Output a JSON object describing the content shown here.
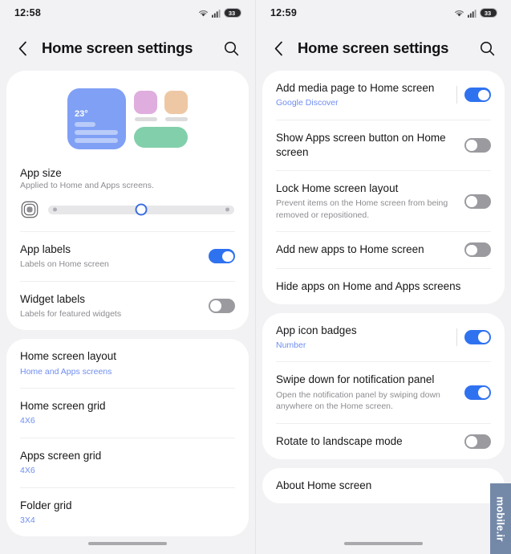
{
  "left": {
    "status": {
      "time": "12:58",
      "battery_level": "33",
      "wifi_icon": "wifi-icon",
      "signal_icon": "cellular-signal-icon"
    },
    "appbar": {
      "back_icon": "chevron-left-icon",
      "title": "Home screen settings",
      "search_icon": "search-icon"
    },
    "preview": {
      "temperature": "23°"
    },
    "app_size": {
      "title": "App size",
      "subtitle": "Applied to Home and Apps screens.",
      "icon": "app-size-icon",
      "value_percent": 50
    },
    "toggle_rows": [
      {
        "title": "App labels",
        "subtitle": "Labels on Home screen",
        "state": "on"
      },
      {
        "title": "Widget labels",
        "subtitle": "Labels for featured widgets",
        "state": "off"
      }
    ],
    "list_rows": [
      {
        "title": "Home screen layout",
        "value": "Home and Apps screens"
      },
      {
        "title": "Home screen grid",
        "value": "4X6"
      },
      {
        "title": "Apps screen grid",
        "value": "4X6"
      },
      {
        "title": "Folder grid",
        "value": "3X4"
      }
    ]
  },
  "right": {
    "status": {
      "time": "12:59",
      "battery_level": "33",
      "wifi_icon": "wifi-icon",
      "signal_icon": "cellular-signal-icon"
    },
    "appbar": {
      "back_icon": "chevron-left-icon",
      "title": "Home screen settings",
      "search_icon": "search-icon"
    },
    "card1": [
      {
        "title": "Add media page to Home screen",
        "subtitle": "Google Discover",
        "sub_is_link": true,
        "control": "toggle",
        "state": "on"
      },
      {
        "title": "Show Apps screen button on Home screen",
        "subtitle": "",
        "control": "toggle",
        "state": "off"
      },
      {
        "title": "Lock Home screen layout",
        "subtitle": "Prevent items on the Home screen from being removed or repositioned.",
        "control": "toggle",
        "state": "off"
      },
      {
        "title": "Add new apps to Home screen",
        "subtitle": "",
        "control": "toggle",
        "state": "off"
      },
      {
        "title": "Hide apps on Home and Apps screens",
        "subtitle": "",
        "control": "none"
      }
    ],
    "card2": [
      {
        "title": "App icon badges",
        "subtitle": "Number",
        "sub_is_link": true,
        "control": "toggle",
        "state": "on"
      },
      {
        "title": "Swipe down for notification panel",
        "subtitle": "Open the notification panel by swiping down anywhere on the Home screen.",
        "control": "toggle",
        "state": "on"
      },
      {
        "title": "Rotate to landscape mode",
        "subtitle": "",
        "control": "toggle",
        "state": "off"
      }
    ],
    "card3": [
      {
        "title": "About Home screen",
        "subtitle": "",
        "control": "none"
      }
    ]
  },
  "watermark": {
    "text": "mobile.ir",
    "color": "#7489a8"
  },
  "colors": {
    "accent_blue": "#2f72f0",
    "link_blue": "#6f8df0",
    "toggle_off": "#9a9a9f",
    "background": "#f2f2f4",
    "card": "#ffffff"
  }
}
